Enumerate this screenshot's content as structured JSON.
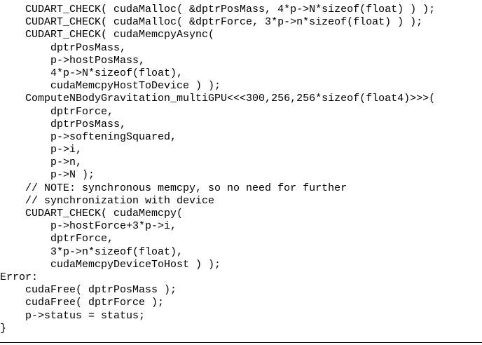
{
  "code": {
    "lines": [
      "    CUDART_CHECK( cudaMalloc( &dptrPosMass, 4*p->N*sizeof(float) ) );",
      "    CUDART_CHECK( cudaMalloc( &dptrForce, 3*p->n*sizeof(float) ) );",
      "    CUDART_CHECK( cudaMemcpyAsync(",
      "        dptrPosMass,",
      "        p->hostPosMass,",
      "        4*p->N*sizeof(float),",
      "        cudaMemcpyHostToDevice ) );",
      "    ComputeNBodyGravitation_multiGPU<<<300,256,256*sizeof(float4)>>>(",
      "        dptrForce,",
      "        dptrPosMass,",
      "        p->softeningSquared,",
      "        p->i,",
      "        p->n,",
      "        p->N );",
      "    // NOTE: synchronous memcpy, so no need for further",
      "    // synchronization with device",
      "    CUDART_CHECK( cudaMemcpy(",
      "        p->hostForce+3*p->i,",
      "        dptrForce,",
      "        3*p->n*sizeof(float),",
      "        cudaMemcpyDeviceToHost ) );",
      "Error:",
      "    cudaFree( dptrPosMass );",
      "    cudaFree( dptrForce );",
      "    p->status = status;",
      "}"
    ]
  }
}
